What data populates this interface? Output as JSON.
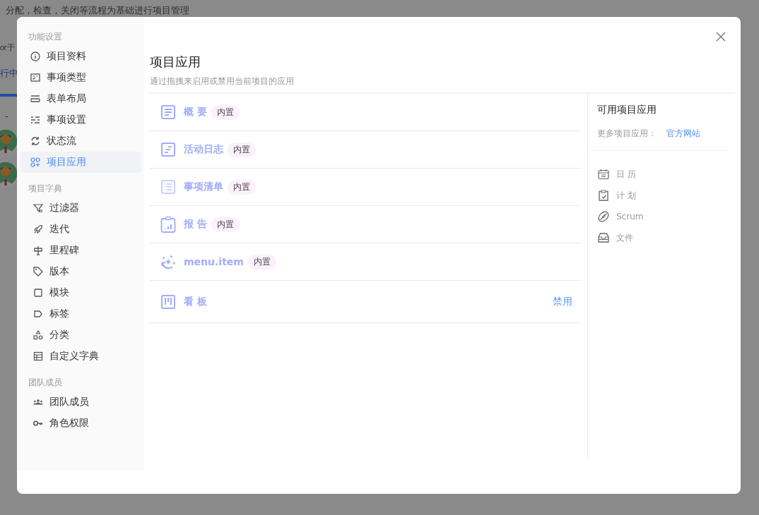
{
  "background_page": {
    "banner_text": "分配，检查，关闭等流程为基础进行项目管理",
    "fragment_1": "or 于",
    "fragment_2": "行中",
    "fragment_3": "-"
  },
  "dialog": {
    "sidebar": {
      "sections": [
        {
          "title": "功能设置",
          "items": [
            {
              "label": "项目资料",
              "selected": false
            },
            {
              "label": "事项类型",
              "selected": false
            },
            {
              "label": "表单布局",
              "selected": false
            },
            {
              "label": "事项设置",
              "selected": false
            },
            {
              "label": "状态流",
              "selected": false
            },
            {
              "label": "项目应用",
              "selected": true
            }
          ]
        },
        {
          "title": "项目字典",
          "items": [
            {
              "label": "过滤器",
              "selected": false
            },
            {
              "label": "迭代",
              "selected": false
            },
            {
              "label": "里程碑",
              "selected": false
            },
            {
              "label": "版本",
              "selected": false
            },
            {
              "label": "模块",
              "selected": false
            },
            {
              "label": "标签",
              "selected": false
            },
            {
              "label": "分类",
              "selected": false
            },
            {
              "label": "自定义字典",
              "selected": false
            }
          ]
        },
        {
          "title": "团队成员",
          "items": [
            {
              "label": "团队成员",
              "selected": false
            },
            {
              "label": "角色权限",
              "selected": false
            }
          ]
        }
      ]
    },
    "title": "项目应用",
    "subtitle": "通过拖拽来启用或禁用当前项目的应用",
    "apps": [
      {
        "label": "概 要",
        "badge": "内置"
      },
      {
        "label": "活动日志",
        "badge": "内置"
      },
      {
        "label": "事项清单",
        "badge": "内置"
      },
      {
        "label": "报 告",
        "badge": "内置"
      },
      {
        "label": "menu.item",
        "badge": "内置"
      },
      {
        "label": "看 板",
        "action": "禁用"
      }
    ],
    "available": {
      "title": "可用项目应用",
      "more_label": "更多项目应用：",
      "more_link": "官方网站",
      "items": [
        {
          "label": "日 历"
        },
        {
          "label": "计 划"
        },
        {
          "label": "Scrum"
        },
        {
          "label": "文件"
        }
      ]
    }
  }
}
